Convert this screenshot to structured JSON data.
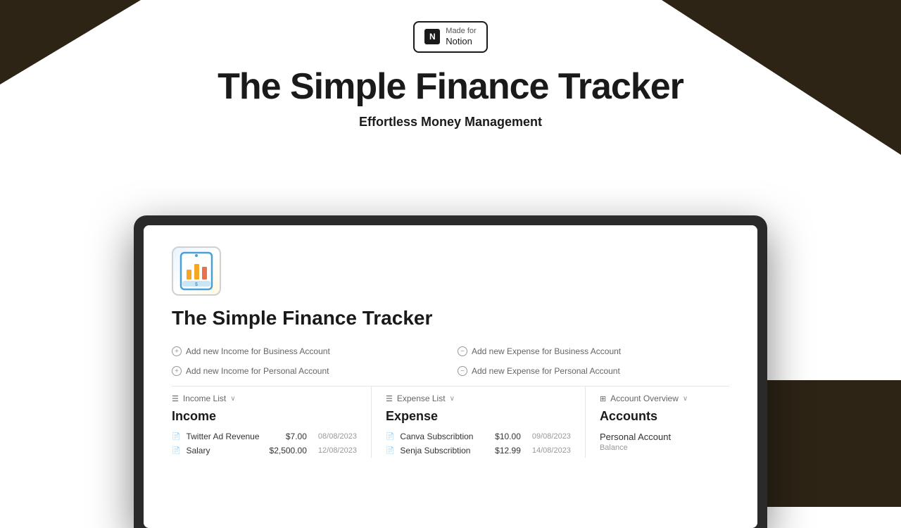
{
  "background": {
    "dark_color": "#2d2416",
    "light_color": "#ffffff"
  },
  "header": {
    "badge": {
      "made_for": "Made for",
      "notion": "Notion"
    },
    "title": "The Simple Finance Tracker",
    "subtitle": "Effortless Money Management"
  },
  "notion_app": {
    "page_title": "The Simple Finance Tracker",
    "action_buttons": {
      "income_business": "Add new Income for Business Account",
      "income_personal": "Add new Income for Personal Account",
      "expense_business": "Add new Expense for Business Account",
      "expense_personal": "Add new Expense for Personal Account"
    },
    "income_section": {
      "header": "Income List",
      "col_title": "Income",
      "rows": [
        {
          "name": "Twitter Ad Revenue",
          "amount": "$7.00",
          "date": "08/08/2023"
        },
        {
          "name": "Salary",
          "amount": "$2,500.00",
          "date": "12/08/2023"
        }
      ]
    },
    "expense_section": {
      "header": "Expense List",
      "col_title": "Expense",
      "rows": [
        {
          "name": "Canva Subscribtion",
          "amount": "$10.00",
          "date": "09/08/2023"
        },
        {
          "name": "Senja Subscribtion",
          "amount": "$12.99",
          "date": "14/08/2023"
        }
      ]
    },
    "account_section": {
      "header": "Account Overview",
      "col_title": "Accounts",
      "rows": [
        {
          "name": "Personal Account",
          "label": "Balance"
        }
      ]
    }
  }
}
